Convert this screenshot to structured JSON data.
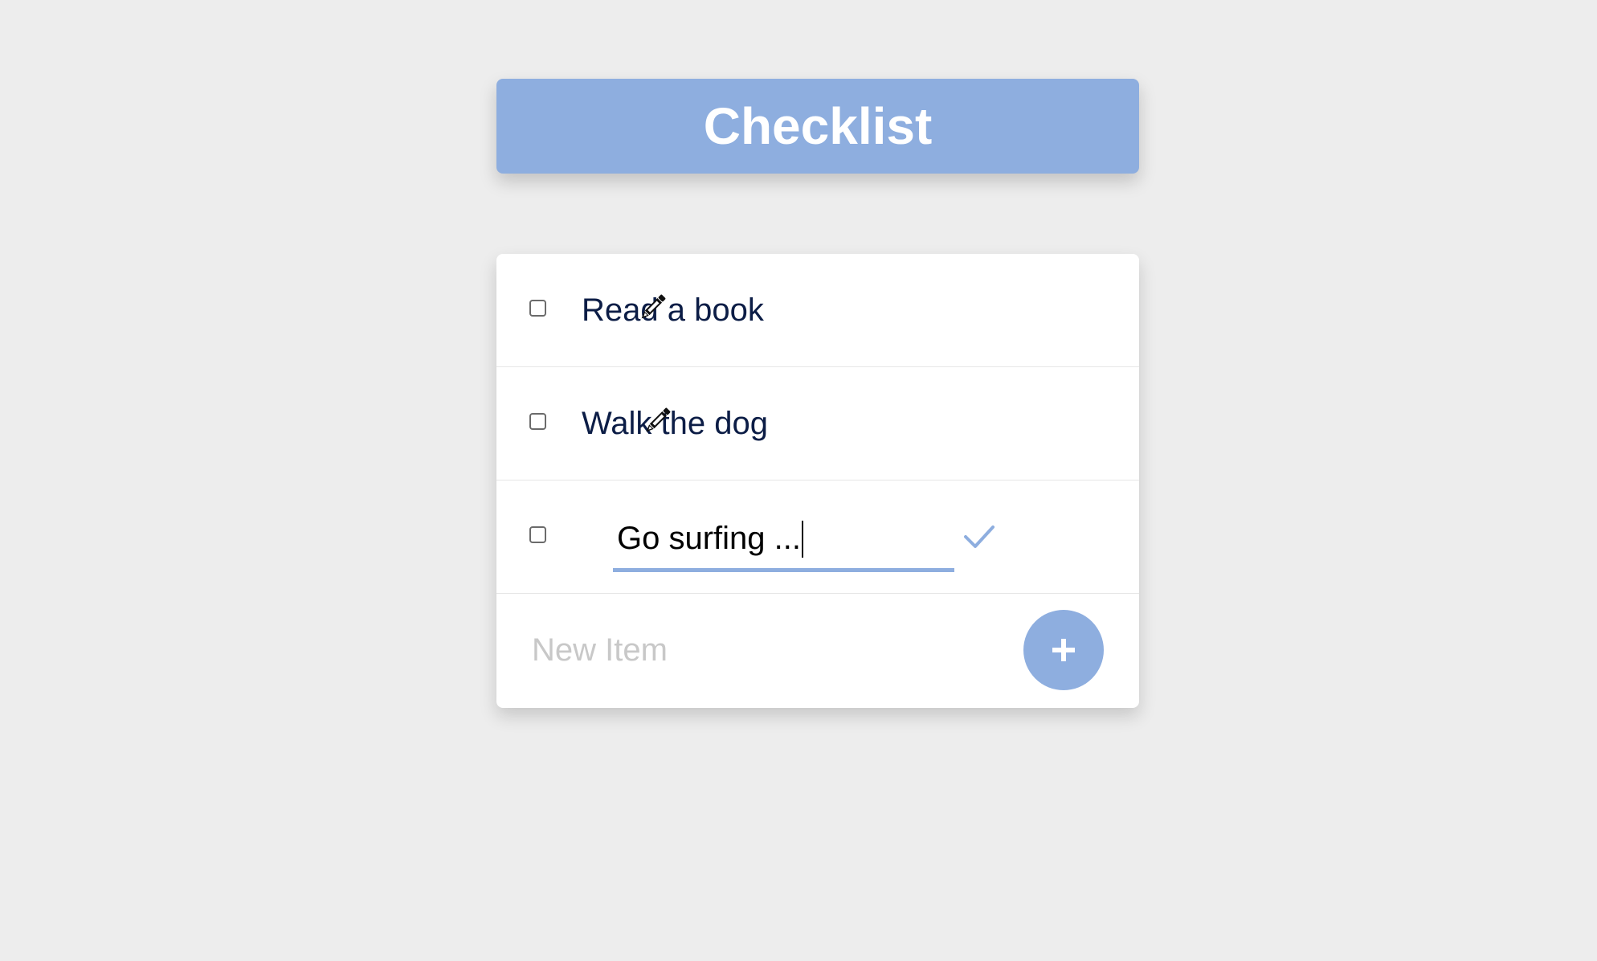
{
  "header": {
    "title": "Checklist"
  },
  "items": [
    {
      "label": "Read a book",
      "checked": false,
      "icon": "pencil-icon"
    },
    {
      "label": "Walk the dog",
      "checked": false,
      "icon": "pencil-icon"
    },
    {
      "value": "Go surfing ...",
      "checked": false,
      "editing": true,
      "icon": "checkmark-icon"
    }
  ],
  "new_item": {
    "placeholder": "New Item",
    "value": "",
    "add_icon": "plus-icon"
  },
  "colors": {
    "accent": "#8eaedf",
    "background": "#ededed",
    "text": "#0c1d46",
    "placeholder": "#c8c8c8"
  }
}
